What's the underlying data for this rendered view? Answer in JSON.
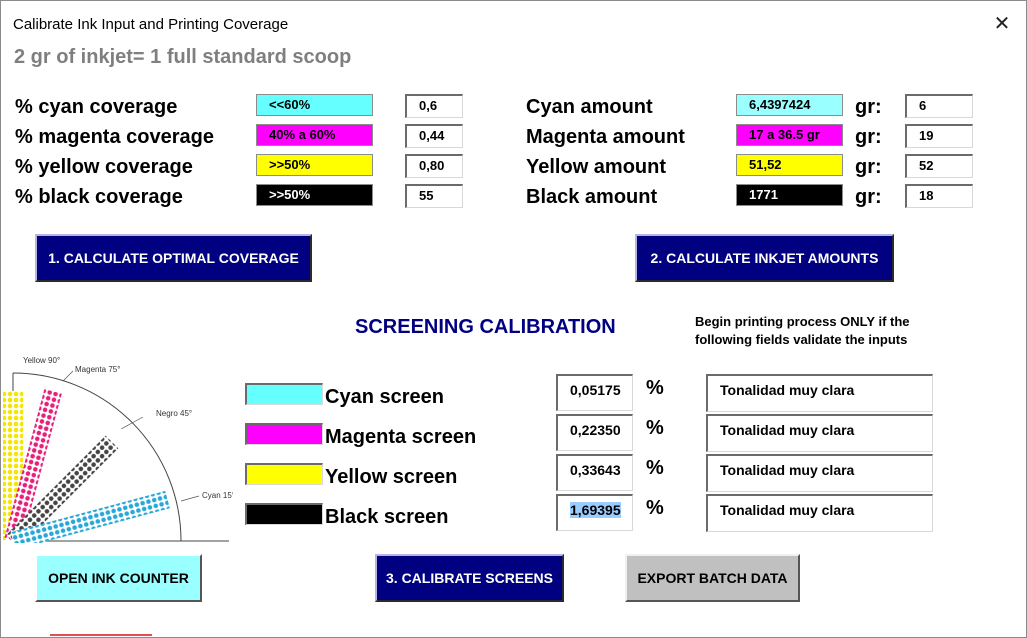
{
  "window": {
    "title": "Calibrate Ink Input and Printing Coverage"
  },
  "subtitle": "2 gr of inkjet= 1 full standard scoop",
  "coverage": [
    {
      "label": "% cyan coverage",
      "chip": "<<60%",
      "chip_color": "#66ffff",
      "chip_text_color": "#000000",
      "value": "0,6"
    },
    {
      "label": "% magenta coverage",
      "chip": "40% a 60%",
      "chip_color": "#ff00ff",
      "chip_text_color": "#000000",
      "value": "0,44"
    },
    {
      "label": "% yellow coverage",
      "chip": ">>50%",
      "chip_color": "#ffff00",
      "chip_text_color": "#000000",
      "value": "0,80"
    },
    {
      "label": "% black coverage",
      "chip": ">>50%",
      "chip_color": "#000000",
      "chip_text_color": "#ffffff",
      "value": "55"
    }
  ],
  "amounts": [
    {
      "label": "Cyan amount",
      "chip": "6,4397424",
      "chip_color": "#99ffff",
      "chip_text_color": "#000000",
      "unit": "gr:",
      "value": "6"
    },
    {
      "label": "Magenta amount",
      "chip": "17 a 36.5 gr",
      "chip_color": "#ff00ff",
      "chip_text_color": "#000000",
      "unit": "gr:",
      "value": "19"
    },
    {
      "label": "Yellow amount",
      "chip": "51,52",
      "chip_color": "#ffff00",
      "chip_text_color": "#000000",
      "unit": "gr:",
      "value": "52"
    },
    {
      "label": "Black amount",
      "chip": "1771",
      "chip_color": "#000000",
      "chip_text_color": "#ffffff",
      "unit": "gr:",
      "value": "18"
    }
  ],
  "buttons": {
    "calc_coverage": "1. CALCULATE OPTIMAL COVERAGE",
    "calc_inkjet": "2. CALCULATE INKJET AMOUNTS",
    "open_counter": "OPEN INK COUNTER",
    "calibrate": "3. CALIBRATE SCREENS",
    "export": "EXPORT BATCH DATA"
  },
  "screening": {
    "title": "SCREENING CALIBRATION",
    "note_line1": "Begin printing process ONLY if the",
    "note_line2": "following fields validate the inputs",
    "rows": [
      {
        "label": "Cyan screen",
        "color": "#66ffff",
        "value": "0,05175",
        "unit": "%",
        "result": "Tonalidad muy clara"
      },
      {
        "label": "Magenta screen",
        "color": "#ff00ff",
        "value": "0,22350",
        "unit": "%",
        "result": "Tonalidad muy clara"
      },
      {
        "label": "Yellow screen",
        "color": "#ffff00",
        "value": "0,33643",
        "unit": "%",
        "result": "Tonalidad muy clara"
      },
      {
        "label": "Black screen",
        "color": "#000000",
        "value": "1,69395",
        "unit": "%",
        "result": "Tonalidad muy clara"
      }
    ]
  },
  "diagram": {
    "yellow_label": "Yellow 90°",
    "magenta_label": "Magenta 75°",
    "black_label": "Negro 45°",
    "cyan_label": "Cyan 15°"
  }
}
